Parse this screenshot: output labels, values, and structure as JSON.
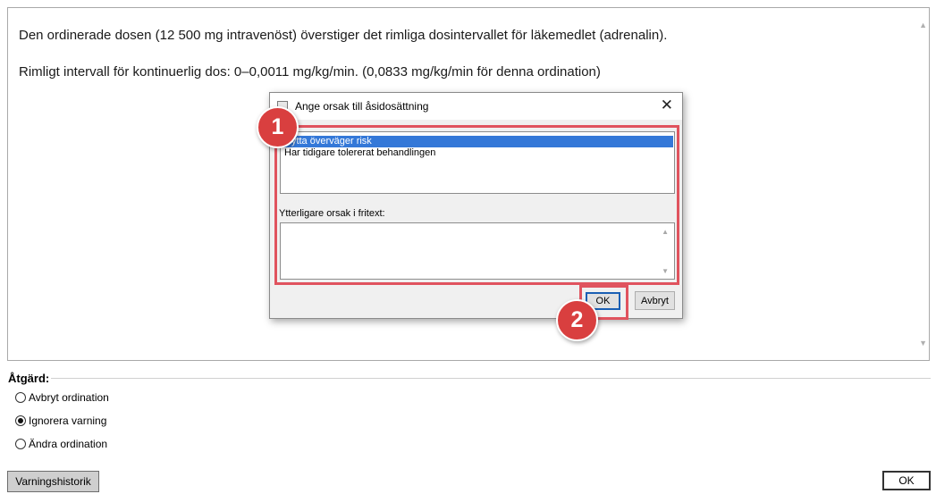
{
  "warning": {
    "line1": "Den ordinerade dosen (12 500 mg intravenöst) överstiger det rimliga dosintervallet för läkemedlet (adrenalin).",
    "line2": "Rimligt intervall för kontinuerlig dos: 0–0,0011 mg/kg/min. (0,0833 mg/kg/min för denna ordination)"
  },
  "dialog": {
    "title": "Ange orsak till åsidosättning",
    "close_glyph": "✕",
    "reasons": [
      {
        "label": "Nytta överväger risk",
        "selected": true
      },
      {
        "label": "Har tidigare tolererat behandlingen",
        "selected": false
      }
    ],
    "freetext_label": "Ytterligare orsak i fritext:",
    "freetext_value": "",
    "ok_label": "OK",
    "cancel_label": "Avbryt"
  },
  "steps": {
    "step1": "1",
    "step2": "2"
  },
  "action": {
    "legend": "Åtgärd:",
    "options": [
      {
        "label": "Avbryt ordination",
        "checked": false
      },
      {
        "label": "Ignorera varning",
        "checked": true
      },
      {
        "label": "Ändra ordination",
        "checked": false
      }
    ]
  },
  "footer": {
    "history_label": "Varningshistorik",
    "ok_label": "OK"
  },
  "colors": {
    "highlight": "#e0535e",
    "step_marker": "#d93f3f",
    "selection": "#3478d8"
  }
}
